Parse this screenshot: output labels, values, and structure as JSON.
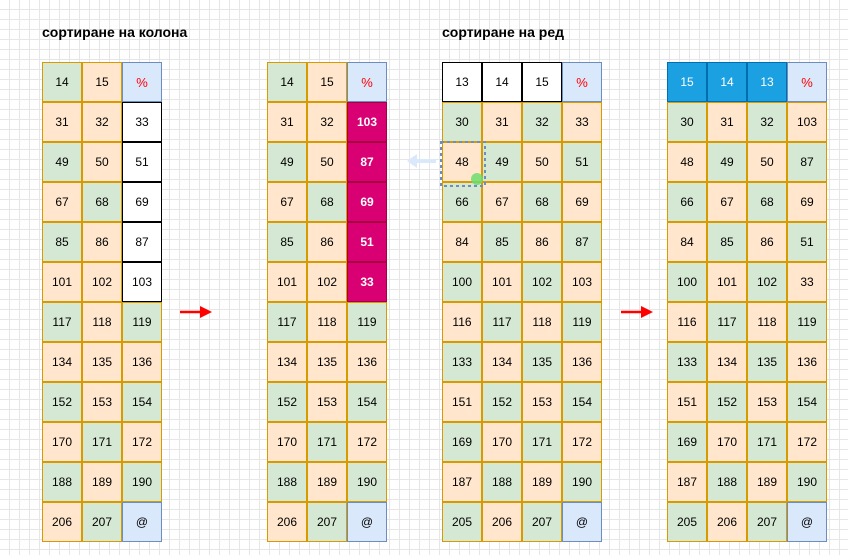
{
  "titles": {
    "column_sort": "сортиране на колона",
    "row_sort": "сортиране на ред"
  },
  "tables": [
    {
      "name": "table-column-before",
      "rows": [
        [
          [
            "14",
            "g"
          ],
          [
            "15",
            "o"
          ],
          [
            "%",
            "b"
          ]
        ],
        [
          [
            "31",
            "o"
          ],
          [
            "32",
            "o"
          ],
          [
            "33",
            "w"
          ]
        ],
        [
          [
            "49",
            "g"
          ],
          [
            "50",
            "o"
          ],
          [
            "51",
            "w"
          ]
        ],
        [
          [
            "67",
            "o"
          ],
          [
            "68",
            "g"
          ],
          [
            "69",
            "w"
          ]
        ],
        [
          [
            "85",
            "g"
          ],
          [
            "86",
            "o"
          ],
          [
            "87",
            "w"
          ]
        ],
        [
          [
            "101",
            "o"
          ],
          [
            "102",
            "o"
          ],
          [
            "103",
            "w"
          ]
        ],
        [
          [
            "117",
            "g"
          ],
          [
            "118",
            "o"
          ],
          [
            "119",
            "g"
          ]
        ],
        [
          [
            "134",
            "o"
          ],
          [
            "135",
            "o"
          ],
          [
            "136",
            "o"
          ]
        ],
        [
          [
            "152",
            "g"
          ],
          [
            "153",
            "o"
          ],
          [
            "154",
            "g"
          ]
        ],
        [
          [
            "170",
            "o"
          ],
          [
            "171",
            "g"
          ],
          [
            "172",
            "o"
          ]
        ],
        [
          [
            "188",
            "g"
          ],
          [
            "189",
            "o"
          ],
          [
            "190",
            "g"
          ]
        ],
        [
          [
            "206",
            "o"
          ],
          [
            "207",
            "g"
          ],
          [
            "@",
            "b"
          ]
        ]
      ]
    },
    {
      "name": "table-column-after",
      "rows": [
        [
          [
            "14",
            "g"
          ],
          [
            "15",
            "o"
          ],
          [
            "%",
            "b"
          ]
        ],
        [
          [
            "31",
            "o"
          ],
          [
            "32",
            "o"
          ],
          [
            "103",
            "m"
          ]
        ],
        [
          [
            "49",
            "g"
          ],
          [
            "50",
            "o"
          ],
          [
            "87",
            "m"
          ]
        ],
        [
          [
            "67",
            "o"
          ],
          [
            "68",
            "g"
          ],
          [
            "69",
            "m"
          ]
        ],
        [
          [
            "85",
            "g"
          ],
          [
            "86",
            "o"
          ],
          [
            "51",
            "m"
          ]
        ],
        [
          [
            "101",
            "o"
          ],
          [
            "102",
            "o"
          ],
          [
            "33",
            "m"
          ]
        ],
        [
          [
            "117",
            "g"
          ],
          [
            "118",
            "o"
          ],
          [
            "119",
            "g"
          ]
        ],
        [
          [
            "134",
            "o"
          ],
          [
            "135",
            "o"
          ],
          [
            "136",
            "o"
          ]
        ],
        [
          [
            "152",
            "g"
          ],
          [
            "153",
            "o"
          ],
          [
            "154",
            "g"
          ]
        ],
        [
          [
            "170",
            "o"
          ],
          [
            "171",
            "g"
          ],
          [
            "172",
            "o"
          ]
        ],
        [
          [
            "188",
            "g"
          ],
          [
            "189",
            "o"
          ],
          [
            "190",
            "g"
          ]
        ],
        [
          [
            "206",
            "o"
          ],
          [
            "207",
            "g"
          ],
          [
            "@",
            "b"
          ]
        ]
      ]
    },
    {
      "name": "table-row-before",
      "rows": [
        [
          [
            "13",
            "w"
          ],
          [
            "14",
            "w"
          ],
          [
            "15",
            "w"
          ],
          [
            "%",
            "b"
          ]
        ],
        [
          [
            "30",
            "g"
          ],
          [
            "31",
            "o"
          ],
          [
            "32",
            "g"
          ],
          [
            "33",
            "o"
          ]
        ],
        [
          [
            "48",
            "o"
          ],
          [
            "49",
            "g"
          ],
          [
            "50",
            "o"
          ],
          [
            "51",
            "g"
          ]
        ],
        [
          [
            "66",
            "g"
          ],
          [
            "67",
            "o"
          ],
          [
            "68",
            "g"
          ],
          [
            "69",
            "o"
          ]
        ],
        [
          [
            "84",
            "o"
          ],
          [
            "85",
            "g"
          ],
          [
            "86",
            "o"
          ],
          [
            "87",
            "g"
          ]
        ],
        [
          [
            "100",
            "g"
          ],
          [
            "101",
            "o"
          ],
          [
            "102",
            "g"
          ],
          [
            "103",
            "o"
          ]
        ],
        [
          [
            "116",
            "o"
          ],
          [
            "117",
            "g"
          ],
          [
            "118",
            "o"
          ],
          [
            "119",
            "g"
          ]
        ],
        [
          [
            "133",
            "g"
          ],
          [
            "134",
            "o"
          ],
          [
            "135",
            "g"
          ],
          [
            "136",
            "o"
          ]
        ],
        [
          [
            "151",
            "o"
          ],
          [
            "152",
            "g"
          ],
          [
            "153",
            "o"
          ],
          [
            "154",
            "g"
          ]
        ],
        [
          [
            "169",
            "g"
          ],
          [
            "170",
            "o"
          ],
          [
            "171",
            "g"
          ],
          [
            "172",
            "o"
          ]
        ],
        [
          [
            "187",
            "o"
          ],
          [
            "188",
            "g"
          ],
          [
            "189",
            "o"
          ],
          [
            "190",
            "g"
          ]
        ],
        [
          [
            "205",
            "g"
          ],
          [
            "206",
            "o"
          ],
          [
            "207",
            "g"
          ],
          [
            "@",
            "b"
          ]
        ]
      ]
    },
    {
      "name": "table-row-after",
      "rows": [
        [
          [
            "15",
            "c"
          ],
          [
            "14",
            "c"
          ],
          [
            "13",
            "c"
          ],
          [
            "%",
            "b"
          ]
        ],
        [
          [
            "30",
            "g"
          ],
          [
            "31",
            "o"
          ],
          [
            "32",
            "g"
          ],
          [
            "103",
            "o"
          ]
        ],
        [
          [
            "48",
            "o"
          ],
          [
            "49",
            "g"
          ],
          [
            "50",
            "o"
          ],
          [
            "87",
            "g"
          ]
        ],
        [
          [
            "66",
            "g"
          ],
          [
            "67",
            "o"
          ],
          [
            "68",
            "g"
          ],
          [
            "69",
            "o"
          ]
        ],
        [
          [
            "84",
            "o"
          ],
          [
            "85",
            "g"
          ],
          [
            "86",
            "o"
          ],
          [
            "51",
            "g"
          ]
        ],
        [
          [
            "100",
            "g"
          ],
          [
            "101",
            "o"
          ],
          [
            "102",
            "g"
          ],
          [
            "33",
            "o"
          ]
        ],
        [
          [
            "116",
            "o"
          ],
          [
            "117",
            "g"
          ],
          [
            "118",
            "o"
          ],
          [
            "119",
            "g"
          ]
        ],
        [
          [
            "133",
            "g"
          ],
          [
            "134",
            "o"
          ],
          [
            "135",
            "g"
          ],
          [
            "136",
            "o"
          ]
        ],
        [
          [
            "151",
            "o"
          ],
          [
            "152",
            "g"
          ],
          [
            "153",
            "o"
          ],
          [
            "154",
            "g"
          ]
        ],
        [
          [
            "169",
            "g"
          ],
          [
            "170",
            "o"
          ],
          [
            "171",
            "g"
          ],
          [
            "172",
            "o"
          ]
        ],
        [
          [
            "187",
            "o"
          ],
          [
            "188",
            "g"
          ],
          [
            "189",
            "o"
          ],
          [
            "190",
            "g"
          ]
        ],
        [
          [
            "205",
            "g"
          ],
          [
            "206",
            "o"
          ],
          [
            "207",
            "g"
          ],
          [
            "@",
            "b"
          ]
        ]
      ]
    }
  ],
  "colors": {
    "arrow": "#ff0000",
    "faded_arrow": "#dae8fc",
    "selection": "#6c8ebf",
    "handle": "#6ddc6d"
  }
}
